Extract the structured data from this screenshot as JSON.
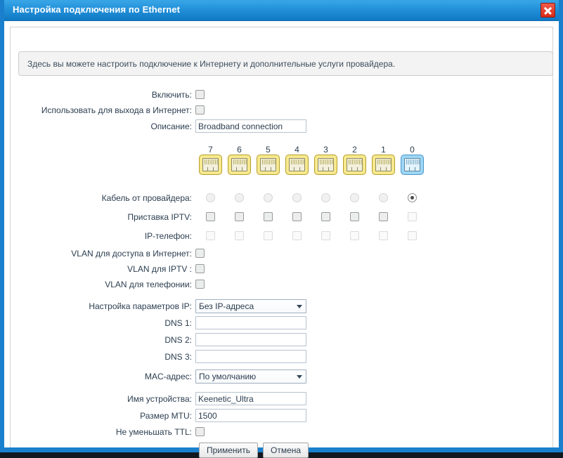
{
  "window": {
    "title": "Настройка подключения по Ethernet",
    "close_label": "×"
  },
  "info": {
    "text": "Здесь вы можете настроить подключение к Интернету и дополнительные услуги провайдера."
  },
  "form": {
    "enable_label": "Включить:",
    "use_for_internet_label": "Использовать для выхода в Интернет:",
    "description_label": "Описание:",
    "description_value": "Broadband connection",
    "isp_cable_label": "Кабель от провайдера:",
    "iptv_box_label": "Приставка IPTV:",
    "ip_phone_label": "IP-телефон:",
    "vlan_internet_label": "VLAN для доступа в Интернет:",
    "vlan_iptv_label": "VLAN для IPTV :",
    "vlan_phone_label": "VLAN для телефонии:",
    "ip_settings_label": "Настройка параметров IP:",
    "ip_settings_value": "Без IP-адреса",
    "dns1_label": "DNS 1:",
    "dns1_value": "",
    "dns2_label": "DNS 2:",
    "dns2_value": "",
    "dns3_label": "DNS 3:",
    "dns3_value": "",
    "mac_label": "MAC-адрес:",
    "mac_value": "По умолчанию",
    "device_name_label": "Имя устройства:",
    "device_name_value": "Keenetic_Ultra",
    "mtu_label": "Размер MTU:",
    "mtu_value": "1500",
    "ttl_label": "Не уменьшать TTL:"
  },
  "ports": {
    "labels": [
      "7",
      "6",
      "5",
      "4",
      "3",
      "2",
      "1",
      "0"
    ],
    "kinds": [
      "lan",
      "lan",
      "lan",
      "lan",
      "lan",
      "lan",
      "lan",
      "wan"
    ],
    "isp_cable": [
      false,
      false,
      false,
      false,
      false,
      false,
      false,
      true
    ],
    "iptv_enabled": [
      true,
      true,
      true,
      true,
      true,
      true,
      true,
      false
    ],
    "ip_phone_enabled": [
      false,
      false,
      false,
      false,
      false,
      false,
      false,
      false
    ]
  },
  "buttons": {
    "apply_label": "Применить",
    "cancel_label": "Отмена"
  },
  "colors": {
    "accent": "#1a80cd",
    "title_gradient_top": "#39a7e6",
    "title_gradient_bottom": "#1179c4",
    "close_red": "#d92b18",
    "lan_port": "#f7e98e",
    "wan_port": "#9cd6f5",
    "text": "#2b3d4f"
  }
}
